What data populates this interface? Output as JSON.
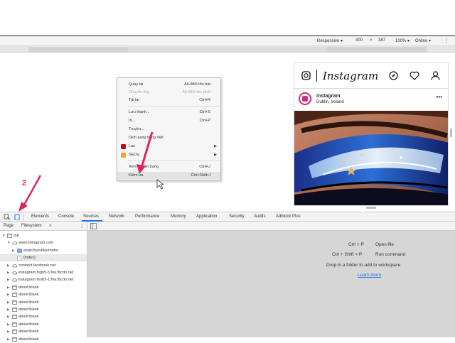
{
  "emulation": {
    "device": "Responsive ▾",
    "width": "400",
    "times": "×",
    "height": "387",
    "zoom": "100% ▾",
    "network": "Online ▾",
    "more": "⋮"
  },
  "context_menu": {
    "items": [
      {
        "label": "Quay lại",
        "shortcut": "Alt+Mũi tên trái",
        "disabled": false
      },
      {
        "label": "Chuyển tiếp",
        "shortcut": "Alt+Mũi tên phải",
        "disabled": true
      },
      {
        "label": "Tải lại",
        "shortcut": "Ctrl+R",
        "disabled": false
      },
      {
        "label": "Lưu thành...",
        "shortcut": "Ctrl+S",
        "disabled": false
      },
      {
        "label": "In...",
        "shortcut": "Ctrl+P",
        "disabled": false
      },
      {
        "label": "Truyền...",
        "shortcut": "",
        "disabled": false
      },
      {
        "label": "Dịch sang tiếng Việt",
        "shortcut": "",
        "disabled": false
      },
      {
        "label": "Laz",
        "shortcut": "",
        "disabled": false
      },
      {
        "label": "SEOq",
        "shortcut": "",
        "disabled": false
      },
      {
        "label": "Xem nguồn trang",
        "shortcut": "Ctrl+U",
        "disabled": false
      },
      {
        "label": "Kiểm tra",
        "shortcut": "Ctrl+Shift+I",
        "disabled": false
      }
    ]
  },
  "instagram": {
    "logo": "Instagram",
    "username": "instagram",
    "location": "Dublin, Ireland",
    "more": "•••"
  },
  "devtools": {
    "tabs": [
      "Elements",
      "Console",
      "Sources",
      "Network",
      "Performance",
      "Memory",
      "Application",
      "Security",
      "Audits",
      "Adblock Plus"
    ],
    "active_tab": "Sources",
    "nav_tabs": {
      "page": "Page",
      "filesystem": "Filesystem",
      "more": "»",
      "menu": "⋮"
    },
    "tree": [
      {
        "label": "top",
        "indent": 0,
        "kind": "frame",
        "twisty": "▼"
      },
      {
        "label": "www.instagram.com",
        "indent": 1,
        "kind": "cloud",
        "twisty": "▼"
      },
      {
        "label": "static/bundles/metro",
        "indent": 2,
        "kind": "folder",
        "twisty": "▶"
      },
      {
        "label": "(index)",
        "indent": 2,
        "kind": "file",
        "twisty": ""
      },
      {
        "label": "connect.facebook.net",
        "indent": 1,
        "kind": "cloud",
        "twisty": "▶"
      },
      {
        "label": "instagram.fsgn5-5.fna.fbcdn.net",
        "indent": 1,
        "kind": "cloud",
        "twisty": "▶"
      },
      {
        "label": "instagram.fsub3-1.fna.fbcdn.net",
        "indent": 1,
        "kind": "cloud",
        "twisty": "▶"
      },
      {
        "label": "about:blank",
        "indent": 1,
        "kind": "frame",
        "twisty": "▶"
      },
      {
        "label": "about:blank",
        "indent": 1,
        "kind": "frame",
        "twisty": "▶"
      },
      {
        "label": "about:blank",
        "indent": 1,
        "kind": "frame",
        "twisty": "▶"
      },
      {
        "label": "about:blank",
        "indent": 1,
        "kind": "frame",
        "twisty": "▶"
      },
      {
        "label": "about:blank",
        "indent": 1,
        "kind": "frame",
        "twisty": "▶"
      },
      {
        "label": "about:blank",
        "indent": 1,
        "kind": "frame",
        "twisty": "▶"
      },
      {
        "label": "about:blank",
        "indent": 1,
        "kind": "frame",
        "twisty": "▶"
      },
      {
        "label": "about:blank",
        "indent": 1,
        "kind": "frame",
        "twisty": "▶"
      }
    ],
    "editor": {
      "open_file_keys": "Ctrl + P",
      "open_file_label": "Open file",
      "run_command_keys": "Ctrl + Shift + P",
      "run_command_label": "Run command",
      "drop_hint": "Drop in a folder to add to workspace",
      "learn_more": "Learn more"
    }
  },
  "annotation": {
    "step": "2"
  },
  "colors": {
    "accent": "#1a73e8",
    "arrow": "#e0245e",
    "ig_gradient": "#d62976"
  }
}
